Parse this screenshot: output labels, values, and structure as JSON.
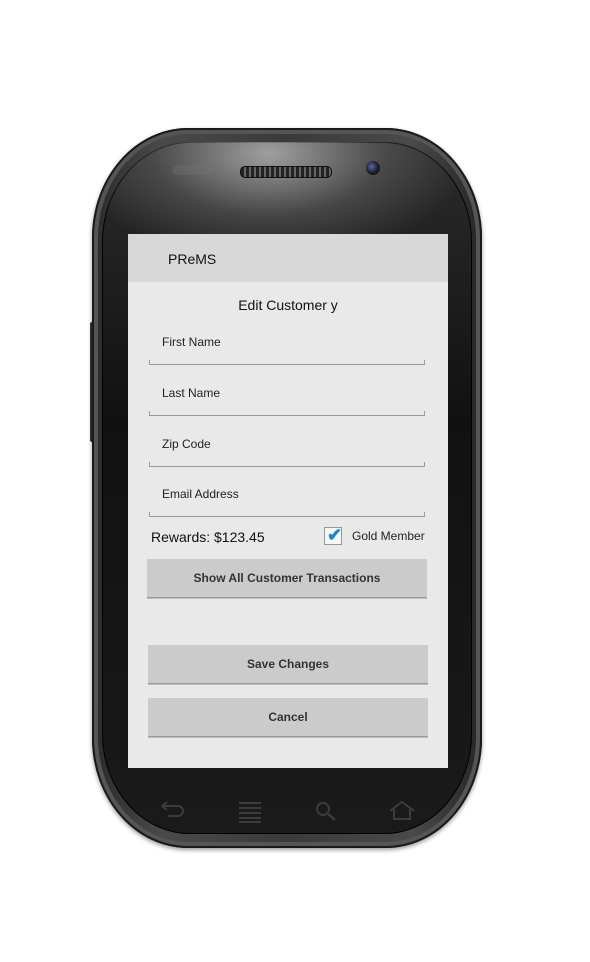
{
  "app": {
    "title": "PReMS"
  },
  "form": {
    "title": "Edit Customer y",
    "fields": [
      {
        "label": "First Name"
      },
      {
        "label": "Last Name"
      },
      {
        "label": "Zip Code"
      },
      {
        "label": "Email Address"
      }
    ],
    "rewards_text": "Rewards: $123.45",
    "gold_member": {
      "label": "Gold Member",
      "checked": true
    }
  },
  "buttons": {
    "transactions": "Show All Customer Transactions",
    "save": "Save Changes",
    "cancel": "Cancel"
  },
  "nav_icons": [
    "back-icon",
    "menu-icon",
    "search-icon",
    "home-icon"
  ],
  "colors": {
    "accent": "#1a88c9",
    "screen_bg": "#e9e9e9",
    "actionbar_bg": "#d8d8d8",
    "button_bg": "#cbcbcb"
  }
}
